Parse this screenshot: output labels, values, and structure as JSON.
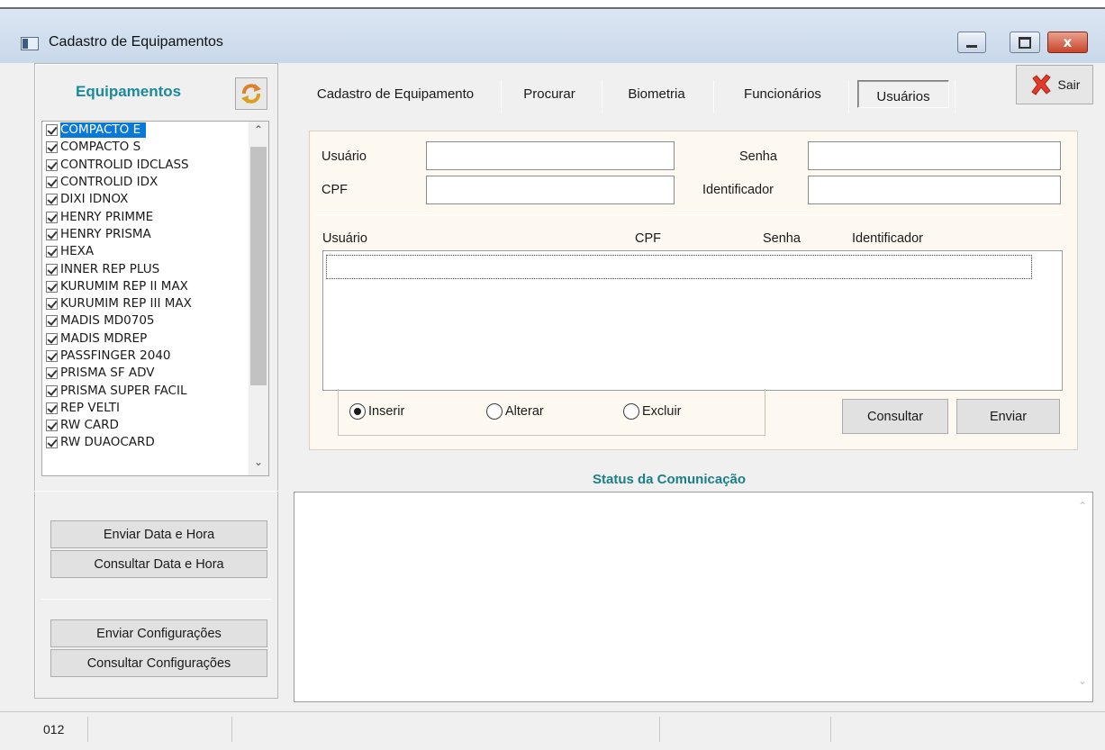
{
  "window": {
    "title": "Cadastro de Equipamentos",
    "close_glyph": "x"
  },
  "equipment": {
    "title": "Equipamentos",
    "items": [
      "COMPACTO E",
      "COMPACTO S",
      "CONTROLID IDCLASS",
      "CONTROLID IDX",
      "DIXI IDNOX",
      "HENRY PRIMME",
      "HENRY PRISMA",
      "HEXA",
      "INNER REP PLUS",
      "KURUMIM REP II MAX",
      "KURUMIM REP III MAX",
      "MADIS MD0705",
      "MADIS MDREP",
      "PASSFINGER 2040",
      "PRISMA SF ADV",
      "PRISMA SUPER FACIL",
      "REP VELTI",
      "RW CARD",
      "RW DUAOCARD"
    ],
    "selected_index": 0
  },
  "left_buttons": {
    "send_datetime": "Enviar Data e Hora",
    "query_datetime": "Consultar Data e Hora",
    "send_config": "Enviar Configurações",
    "query_config": "Consultar Configurações"
  },
  "tabs": [
    "Cadastro de Equipamento",
    "Procurar",
    "Biometria",
    "Funcionários",
    "Usuários"
  ],
  "active_tab": "Usuários",
  "exit_label": "Sair",
  "form": {
    "usuario_label": "Usuário",
    "cpf_label": "CPF",
    "senha_label": "Senha",
    "identificador_label": "Identificador",
    "usuario_value": "",
    "cpf_value": "",
    "senha_value": "",
    "identificador_value": ""
  },
  "grid": {
    "headers": [
      "Usuário",
      "CPF",
      "Senha",
      "Identificador"
    ]
  },
  "actions": {
    "inserir": "Inserir",
    "alterar": "Alterar",
    "excluir": "Excluir",
    "selected": "Inserir",
    "consultar": "Consultar",
    "enviar": "Enviar"
  },
  "status": {
    "title": "Status da Comunicação"
  },
  "statusbar": {
    "cell1": "012"
  }
}
